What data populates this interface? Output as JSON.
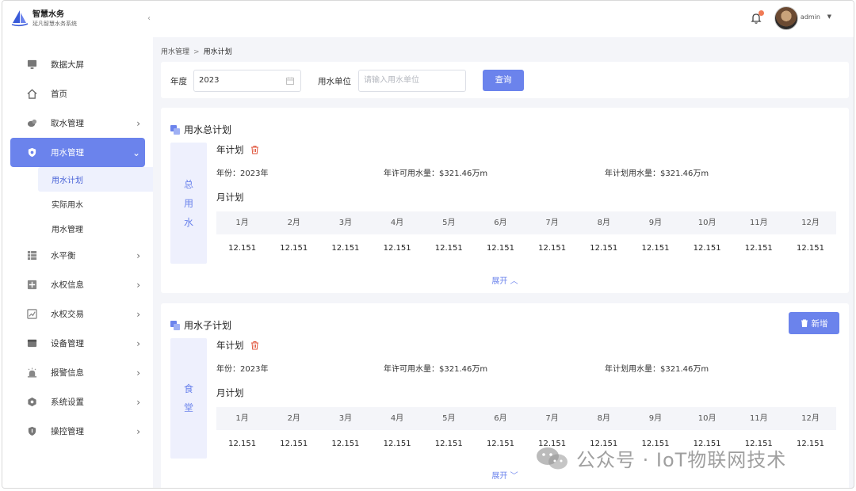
{
  "app": {
    "title": "智慧水务",
    "subtitle": "延凡智慧水务系统"
  },
  "header": {
    "username": "admin"
  },
  "sidebar": {
    "items": [
      {
        "label": "数据大屏",
        "icon": "monitor-icon",
        "arrow": false
      },
      {
        "label": "首页",
        "icon": "home-icon",
        "arrow": false
      },
      {
        "label": "取水管理",
        "icon": "drop-icon",
        "arrow": true
      },
      {
        "label": "用水管理",
        "icon": "shield-icon",
        "arrow": true,
        "active": true
      },
      {
        "label": "水平衡",
        "icon": "grid-icon",
        "arrow": true
      },
      {
        "label": "水权信息",
        "icon": "plus-box-icon",
        "arrow": true
      },
      {
        "label": "水权交易",
        "icon": "chart-box-icon",
        "arrow": true
      },
      {
        "label": "设备管理",
        "icon": "device-icon",
        "arrow": true
      },
      {
        "label": "报警信息",
        "icon": "alarm-icon",
        "arrow": true
      },
      {
        "label": "系统设置",
        "icon": "hex-gear-icon",
        "arrow": true
      },
      {
        "label": "操控管理",
        "icon": "shield-control-icon",
        "arrow": true
      }
    ],
    "submenu": [
      "用水计划",
      "实际用水",
      "用水管理"
    ]
  },
  "breadcrumb": {
    "parent": "用水管理",
    "current": "用水计划"
  },
  "search": {
    "year_label": "年度",
    "year_value": "2023",
    "unit_label": "用水单位",
    "unit_placeholder": "请输入用水单位",
    "button": "查询"
  },
  "total_plan": {
    "title": "用水总计划",
    "side_label": [
      "总",
      "用",
      "水"
    ],
    "year_plan_label": "年计划",
    "year_text": "年份：2023年",
    "allowed_text": "年许可用水量：$321.46万m",
    "planned_text": "年计划用水量：$321.46万m",
    "month_plan_label": "月计划",
    "months": [
      "1月",
      "2月",
      "3月",
      "4月",
      "5月",
      "6月",
      "7月",
      "8月",
      "9月",
      "10月",
      "11月",
      "12月"
    ],
    "values": [
      "12.151",
      "12.151",
      "12.151",
      "12.151",
      "12.151",
      "12.151",
      "12.151",
      "12.151",
      "12.151",
      "12.151",
      "12.151",
      "12.151"
    ],
    "expand": "展开 ︿"
  },
  "sub_plan": {
    "title": "用水子计划",
    "add_button": "新增",
    "side_label": [
      "食",
      "堂"
    ],
    "year_plan_label": "年计划",
    "year_text": "年份：2023年",
    "allowed_text": "年许可用水量：$321.46万m",
    "planned_text": "年计划用水量：$321.46万m",
    "month_plan_label": "月计划",
    "months": [
      "1月",
      "2月",
      "3月",
      "4月",
      "5月",
      "6月",
      "7月",
      "8月",
      "9月",
      "10月",
      "11月",
      "12月"
    ],
    "values": [
      "12.151",
      "12.151",
      "12.151",
      "12.151",
      "12.151",
      "12.151",
      "12.151",
      "12.151",
      "12.151",
      "12.151",
      "12.151",
      "12.151"
    ],
    "expand": "展开 ﹀"
  },
  "watermark": "公众号 · IoT物联网技术",
  "colors": {
    "accent": "#6b83ec",
    "danger": "#f07a55",
    "bg": "#f4f5f9"
  }
}
